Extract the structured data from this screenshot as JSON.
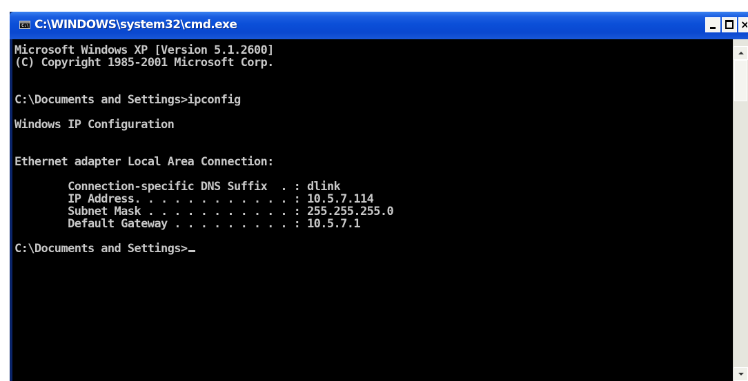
{
  "window": {
    "title": "C:\\WINDOWS\\system32\\cmd.exe",
    "icon": "console-window-icon",
    "icon_text": "C:\\"
  },
  "title_buttons": {
    "minimize_icon": "minimize-icon",
    "maximize_icon": "maximize-icon",
    "close_label": "×"
  },
  "console": {
    "banner_line1": "Microsoft Windows XP [Version 5.1.2600]",
    "banner_line2": "(C) Copyright 1985-2001 Microsoft Corp.",
    "prompt1": "C:\\Documents and Settings>ipconfig",
    "config_heading": "Windows IP Configuration",
    "adapter_heading": "Ethernet adapter Local Area Connection:",
    "rows": [
      {
        "label": "        Connection-specific DNS Suffix  . : ",
        "value": "dlink"
      },
      {
        "label": "        IP Address. . . . . . . . . . . . : ",
        "value": "10.5.7.114"
      },
      {
        "label": "        Subnet Mask . . . . . . . . . . . : ",
        "value": "255.255.255.0"
      },
      {
        "label": "        Default Gateway . . . . . . . . . : ",
        "value": "10.5.7.1"
      }
    ],
    "prompt2": "C:\\Documents and Settings>"
  },
  "colors": {
    "console_bg": "#000000",
    "console_fg": "#c8c8c8",
    "titlebar": "#0b4fd8"
  }
}
